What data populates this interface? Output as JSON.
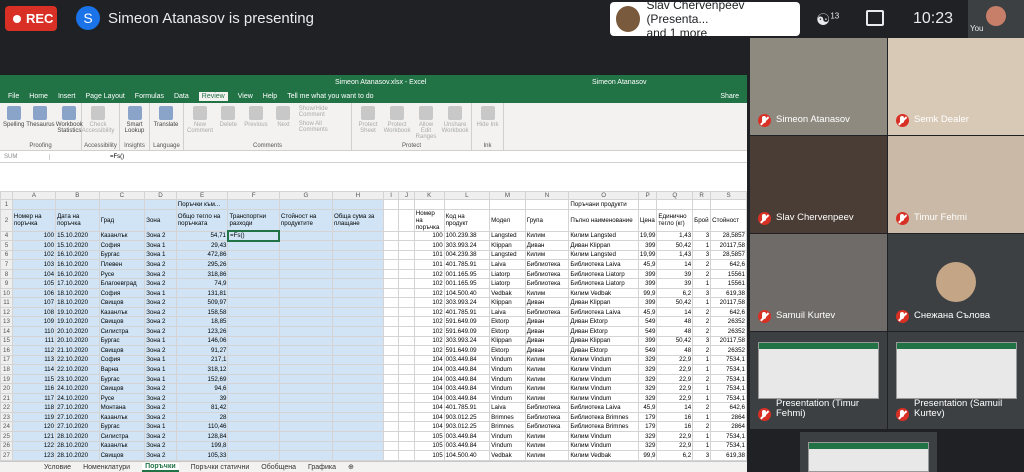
{
  "topbar": {
    "rec_label": "REC",
    "presenter_initial": "S",
    "presenter_text": "Simeon Atanasov is presenting",
    "presentation_card_line1": "Slav Chervenpeev (Presenta...",
    "presentation_card_line2": "and 1 more",
    "people_count": "13",
    "time": "10:23",
    "you_label": "You"
  },
  "excel": {
    "title": "Simeon Atanasov.xlsx - Excel",
    "user": "Simeon Atanasov",
    "tabs": [
      "File",
      "Home",
      "Insert",
      "Page Layout",
      "Formulas",
      "Data",
      "Review",
      "View",
      "Help",
      "Tell me what you want to do"
    ],
    "active_tab": "Review",
    "share": "Share",
    "ribbon_groups": [
      {
        "label": "Proofing",
        "buttons": [
          {
            "label": "Spelling",
            "enabled": true
          },
          {
            "label": "Thesaurus",
            "enabled": true
          },
          {
            "label": "Workbook Statistics",
            "enabled": true
          }
        ]
      },
      {
        "label": "Accessibility",
        "buttons": [
          {
            "label": "Check Accessibility",
            "enabled": false
          }
        ]
      },
      {
        "label": "Insights",
        "buttons": [
          {
            "label": "Smart Lookup",
            "enabled": true
          }
        ]
      },
      {
        "label": "Language",
        "buttons": [
          {
            "label": "Translate",
            "enabled": true
          }
        ]
      },
      {
        "label": "Comments",
        "buttons": [
          {
            "label": "New Comment",
            "enabled": false
          },
          {
            "label": "Delete",
            "enabled": false
          },
          {
            "label": "Previous",
            "enabled": false
          },
          {
            "label": "Next",
            "enabled": false
          },
          {
            "label": "Show/Hide Comment",
            "enabled": false
          },
          {
            "label": "Show All Comments",
            "enabled": false
          }
        ]
      },
      {
        "label": "Protect",
        "buttons": [
          {
            "label": "Protect Sheet",
            "enabled": false
          },
          {
            "label": "Protect Workbook",
            "enabled": false
          },
          {
            "label": "Allow Edit Ranges",
            "enabled": false
          },
          {
            "label": "Unshare Workbook",
            "enabled": false
          }
        ]
      },
      {
        "label": "Ink",
        "buttons": [
          {
            "label": "Hide Ink",
            "enabled": false
          }
        ]
      }
    ],
    "name_box": "SUM",
    "formula": "=Fs()",
    "columns": [
      "A",
      "B",
      "C",
      "D",
      "E",
      "F",
      "G",
      "H",
      "I",
      "J",
      "K",
      "L",
      "M",
      "N",
      "O",
      "P",
      "Q",
      "R",
      "S"
    ],
    "header_row1_left": "Поръчки към...",
    "header_row1_right": "Поръчани продукти",
    "headers_left": [
      "Номер на поръчка",
      "Дата на поръчка",
      "Град",
      "Зона",
      "Общо тегло на поръчката",
      "Транспортни разходи",
      "Стойност на продуктите",
      "Обща сума за плащане"
    ],
    "headers_right": [
      "Номер на поръчка",
      "Код на продукт",
      "Модел",
      "Група",
      "Пълно наименование",
      "Цена",
      "Единично тегло (кг)",
      "Брой",
      "Стойност"
    ],
    "active_cell_value": "=Fs()",
    "rows_left": [
      [
        "4",
        "100",
        "15.10.2020",
        "Казанлък",
        "Зона 2",
        "54,71"
      ],
      [
        "5",
        "100",
        "15.10.2020",
        "София",
        "Зона 1",
        "29,43"
      ],
      [
        "6",
        "102",
        "16.10.2020",
        "Бургас",
        "Зона 1",
        "472,86"
      ],
      [
        "7",
        "103",
        "16.10.2020",
        "Плевен",
        "Зона 2",
        "295,26"
      ],
      [
        "8",
        "104",
        "16.10.2020",
        "Русе",
        "Зона 2",
        "318,86"
      ],
      [
        "9",
        "105",
        "17.10.2020",
        "Благоевград",
        "Зона 2",
        "74,9"
      ],
      [
        "10",
        "106",
        "18.10.2020",
        "София",
        "Зона 1",
        "131,81"
      ],
      [
        "11",
        "107",
        "18.10.2020",
        "Свищов",
        "Зона 2",
        "509,97"
      ],
      [
        "12",
        "108",
        "19.10.2020",
        "Казанлък",
        "Зона 2",
        "158,58"
      ],
      [
        "13",
        "109",
        "19.10.2020",
        "Свищов",
        "Зона 2",
        "18,85"
      ],
      [
        "14",
        "110",
        "20.10.2020",
        "Силистра",
        "Зона 2",
        "123,26"
      ],
      [
        "15",
        "111",
        "20.10.2020",
        "Бургас",
        "Зона 1",
        "146,06"
      ],
      [
        "16",
        "112",
        "21.10.2020",
        "Свищов",
        "Зона 2",
        "91,27"
      ],
      [
        "17",
        "113",
        "22.10.2020",
        "София",
        "Зона 1",
        "217,1"
      ],
      [
        "18",
        "114",
        "22.10.2020",
        "Варна",
        "Зона 1",
        "318,12"
      ],
      [
        "19",
        "115",
        "23.10.2020",
        "Бургас",
        "Зона 1",
        "152,69"
      ],
      [
        "20",
        "116",
        "24.10.2020",
        "Свищов",
        "Зона 2",
        "94,6"
      ],
      [
        "21",
        "117",
        "24.10.2020",
        "Русе",
        "Зона 2",
        "39"
      ],
      [
        "22",
        "118",
        "27.10.2020",
        "Монтана",
        "Зона 2",
        "81,42"
      ],
      [
        "23",
        "119",
        "27.10.2020",
        "Казанлък",
        "Зона 2",
        "28"
      ],
      [
        "24",
        "120",
        "27.10.2020",
        "Бургас",
        "Зона 1",
        "110,46"
      ],
      [
        "25",
        "121",
        "28.10.2020",
        "Силистра",
        "Зона 2",
        "128,84"
      ],
      [
        "26",
        "122",
        "28.10.2020",
        "Казанлък",
        "Зона 2",
        "199,8"
      ],
      [
        "27",
        "123",
        "28.10.2020",
        "Свищов",
        "Зона 2",
        "105,33"
      ]
    ],
    "rows_right": [
      [
        "100",
        "100.239.38",
        "Langsted",
        "Килим",
        "Килим Langsted",
        "19,99",
        "1,43",
        "3",
        "28,5857"
      ],
      [
        "100",
        "303.993.24",
        "Klippan",
        "Диван",
        "Диван Klippan",
        "399",
        "50,42",
        "1",
        "20117,58"
      ],
      [
        "101",
        "004.239.38",
        "Langsted",
        "Килим",
        "Килим Langsted",
        "19,99",
        "1,43",
        "3",
        "28,5857"
      ],
      [
        "101",
        "401.785.91",
        "Laiva",
        "Библиотека",
        "Библиотека Laiva",
        "45,9",
        "14",
        "2",
        "642,6"
      ],
      [
        "102",
        "001.165.95",
        "Liatorp",
        "Библиотека",
        "Библиотека Liatorp",
        "399",
        "39",
        "2",
        "15561"
      ],
      [
        "102",
        "001.165.95",
        "Liatorp",
        "Библиотека",
        "Библиотека Liatorp",
        "399",
        "39",
        "1",
        "15561"
      ],
      [
        "102",
        "104.500.40",
        "Vedbak",
        "Килим",
        "Килим Vedbak",
        "99,9",
        "6,2",
        "3",
        "619,38"
      ],
      [
        "102",
        "303.993.24",
        "Klippan",
        "Диван",
        "Диван Klippan",
        "399",
        "50,42",
        "1",
        "20117,58"
      ],
      [
        "102",
        "401.785.91",
        "Laiva",
        "Библиотека",
        "Библиотека Laiva",
        "45,9",
        "14",
        "2",
        "642,6"
      ],
      [
        "102",
        "591.649.09",
        "Ektorp",
        "Диван",
        "Диван Ektorp",
        "549",
        "48",
        "2",
        "26352"
      ],
      [
        "102",
        "591.649.09",
        "Ektorp",
        "Диван",
        "Диван Ektorp",
        "549",
        "48",
        "2",
        "26352"
      ],
      [
        "102",
        "303.993.24",
        "Klippan",
        "Диван",
        "Диван Klippan",
        "399",
        "50,42",
        "3",
        "20117,58"
      ],
      [
        "102",
        "591.649.09",
        "Ektorp",
        "Диван",
        "Диван Ektorp",
        "549",
        "48",
        "2",
        "26352"
      ],
      [
        "104",
        "003.449.84",
        "Vindum",
        "Килим",
        "Килим Vindum",
        "329",
        "22,9",
        "1",
        "7534,1"
      ],
      [
        "104",
        "003.449.84",
        "Vindum",
        "Килим",
        "Килим Vindum",
        "329",
        "22,9",
        "1",
        "7534,1"
      ],
      [
        "104",
        "003.449.84",
        "Vindum",
        "Килим",
        "Килим Vindum",
        "329",
        "22,9",
        "2",
        "7534,1"
      ],
      [
        "104",
        "003.449.84",
        "Vindum",
        "Килим",
        "Килим Vindum",
        "329",
        "22,9",
        "1",
        "7534,1"
      ],
      [
        "104",
        "003.449.84",
        "Vindum",
        "Килим",
        "Килим Vindum",
        "329",
        "22,9",
        "1",
        "7534,1"
      ],
      [
        "104",
        "401.785.91",
        "Laiva",
        "Библиотека",
        "Библиотека Laiva",
        "45,9",
        "14",
        "2",
        "642,6"
      ],
      [
        "104",
        "903.012.25",
        "Brimnes",
        "Библиотека",
        "Библиотека Brimnes",
        "179",
        "16",
        "1",
        "2864"
      ],
      [
        "104",
        "903.012.25",
        "Brimnes",
        "Библиотека",
        "Библиотека Brimnes",
        "179",
        "16",
        "2",
        "2864"
      ],
      [
        "105",
        "003.449.84",
        "Vindum",
        "Килим",
        "Килим Vindum",
        "329",
        "22,9",
        "1",
        "7534,1"
      ],
      [
        "105",
        "003.449.84",
        "Vindum",
        "Килим",
        "Килим Vindum",
        "329",
        "22,9",
        "1",
        "7534,1"
      ],
      [
        "105",
        "104.500.40",
        "Vedbak",
        "Килим",
        "Килим Vedbak",
        "99,9",
        "6,2",
        "3",
        "619,38"
      ]
    ],
    "sheet_tabs": [
      "Условие",
      "Номенклатури",
      "Поръчки",
      "Поръчки статични",
      "Обобщена",
      "Графика"
    ],
    "active_sheet": "Поръчки"
  },
  "participants": [
    {
      "name": "Simeon Atanasov",
      "muted": true,
      "type": "camera"
    },
    {
      "name": "Semk Dealer",
      "muted": true,
      "type": "camera"
    },
    {
      "name": "Slav Chervenpeev",
      "muted": true,
      "type": "camera"
    },
    {
      "name": "Timur Fehmi",
      "muted": true,
      "type": "camera"
    },
    {
      "name": "Samuil Kurtev",
      "muted": true,
      "type": "camera"
    },
    {
      "name": "Снежана Сълова",
      "muted": true,
      "type": "avatar"
    },
    {
      "name": "Presentation (Timur Fehmi)",
      "muted": true,
      "type": "screen"
    },
    {
      "name": "Presentation (Samuil Kurtev)",
      "muted": true,
      "type": "screen"
    },
    {
      "name": "",
      "muted": false,
      "type": "screen"
    }
  ],
  "colors": {
    "rec": "#d93025",
    "excel_green": "#217346",
    "meet_bg": "#202124",
    "selection": "#d0e4f5"
  }
}
